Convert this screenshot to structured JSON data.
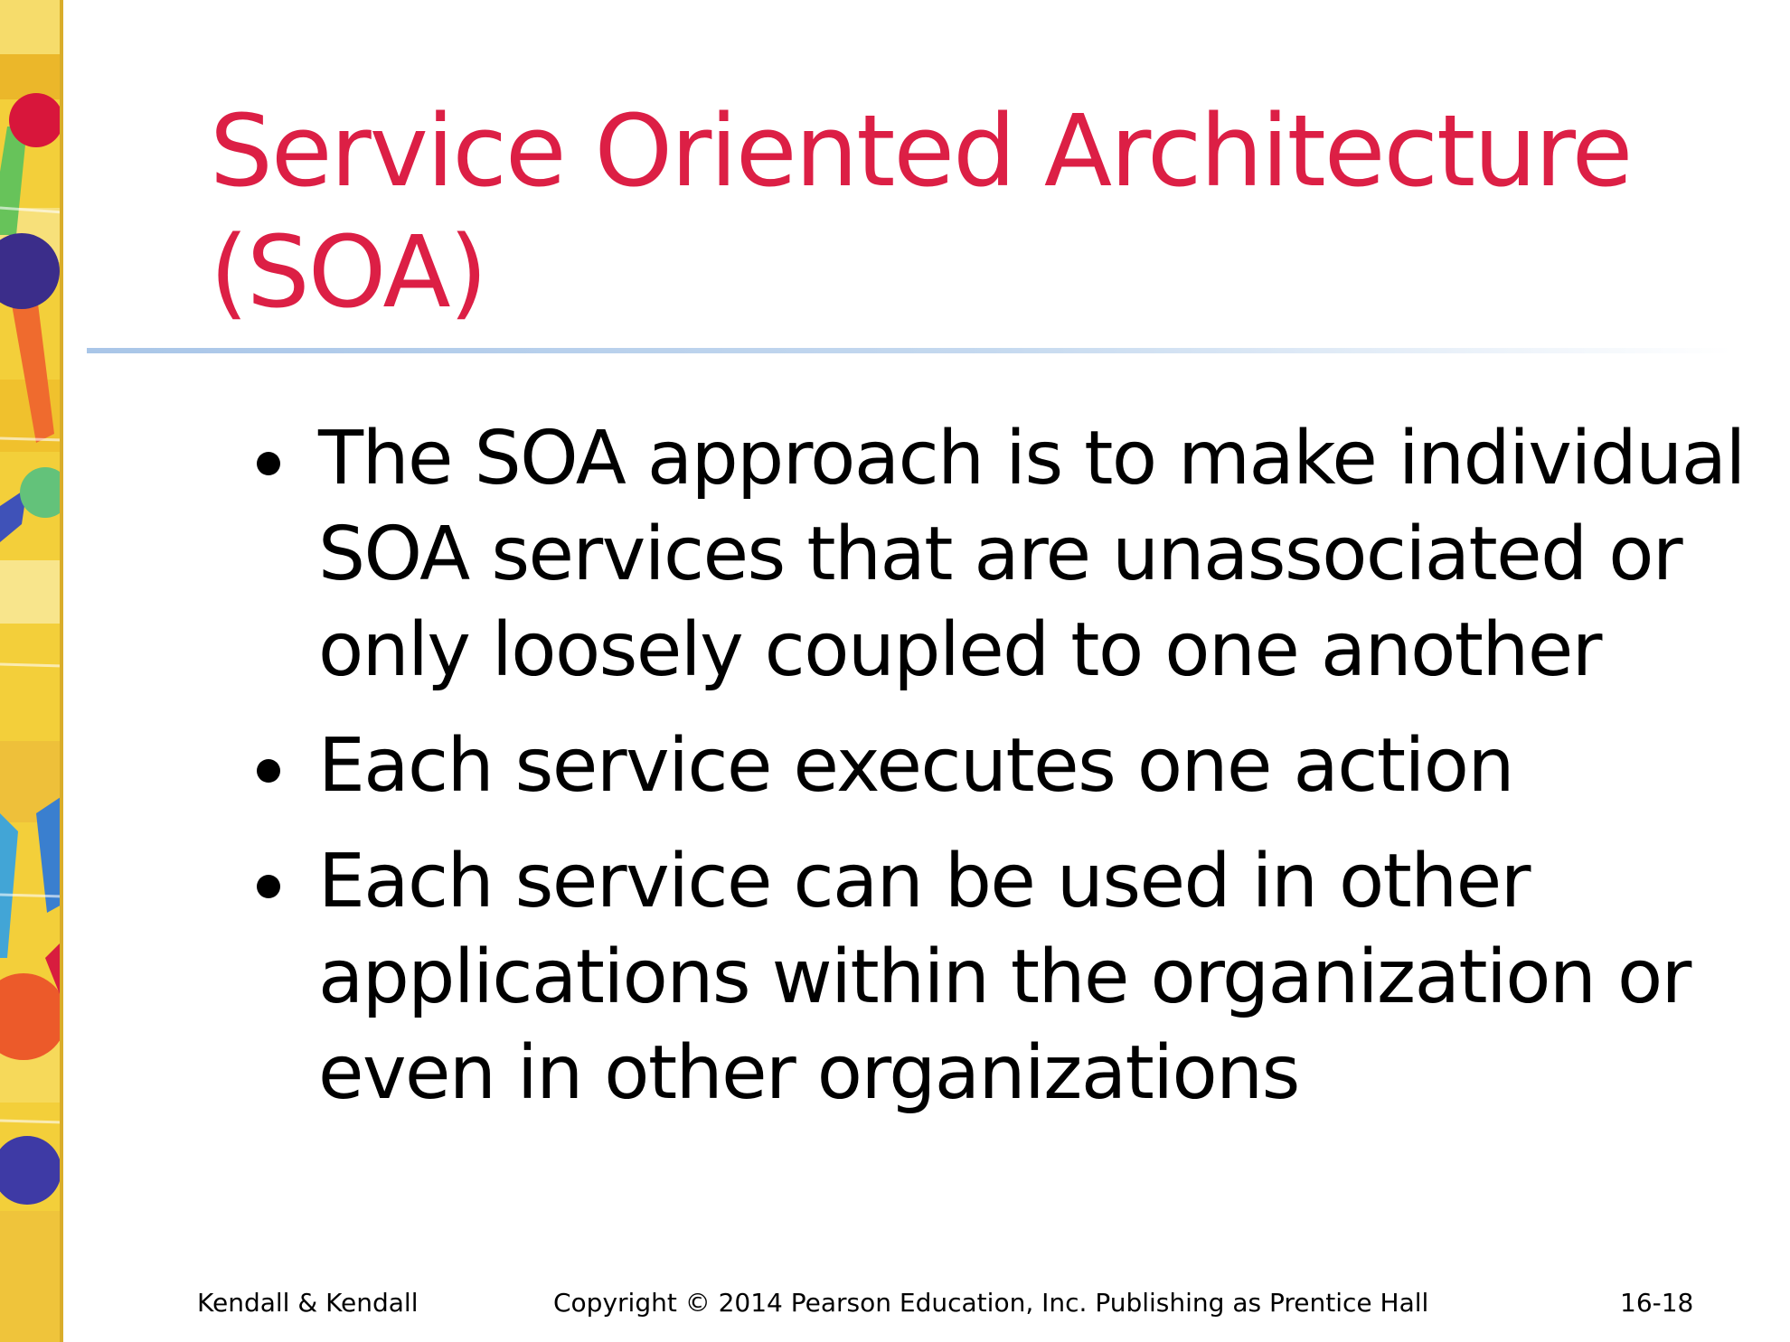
{
  "slide": {
    "title_lines": [
      "Service Oriented Architecture",
      "(SOA)"
    ],
    "bullets": [
      {
        "lines": [
          "The SOA approach is to make individual",
          "SOA services that are unassociated or",
          "only loosely coupled to one another"
        ]
      },
      {
        "lines": [
          "Each service executes one action"
        ]
      },
      {
        "lines": [
          "Each service can be used in other",
          "applications within the organization or",
          "even in other organizations"
        ]
      }
    ],
    "footer": {
      "left": "Kendall & Kendall",
      "center": "Copyright © 2014 Pearson Education, Inc. Publishing as Prentice Hall",
      "right": "16-18"
    }
  },
  "colors": {
    "title": "#dc1f45",
    "text": "#000000",
    "rule": "#a9c6e8"
  }
}
